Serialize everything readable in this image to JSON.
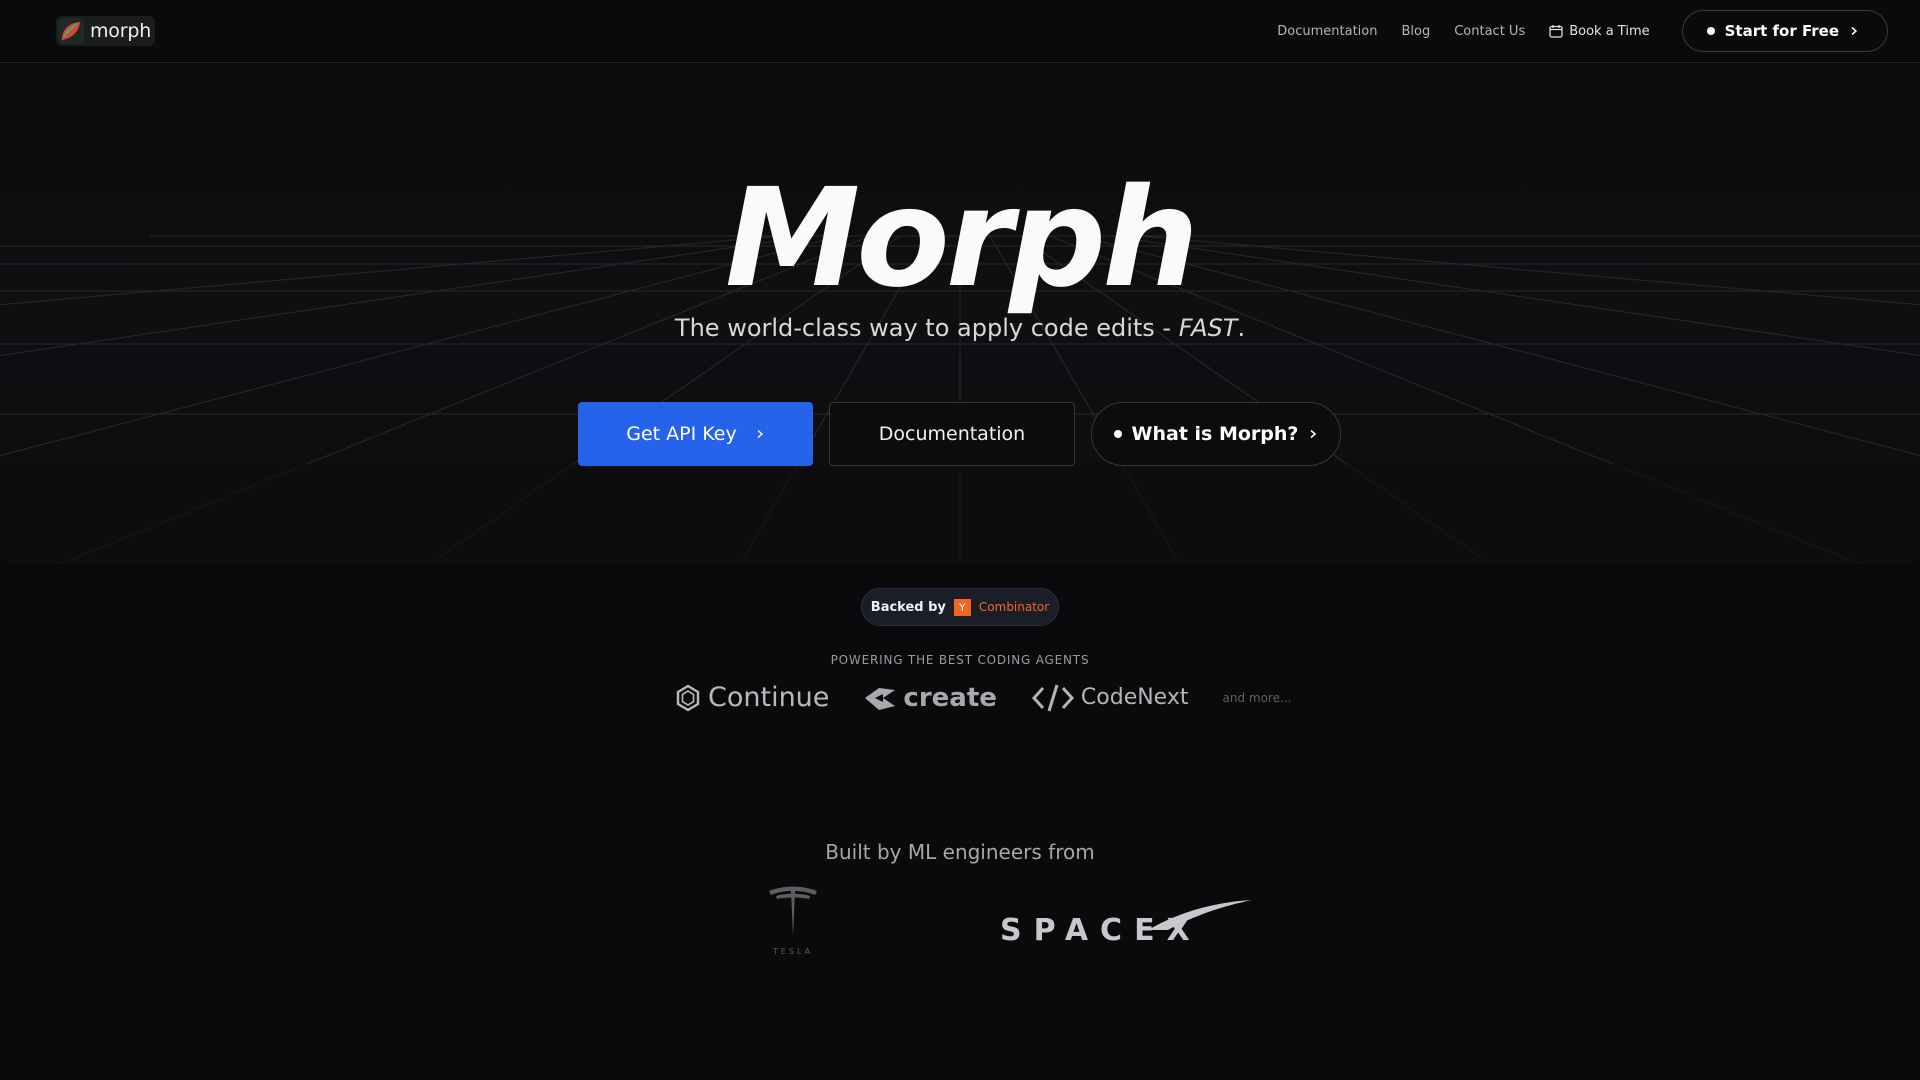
{
  "nav": {
    "logo_text": "morph",
    "links": [
      "Documentation",
      "Blog",
      "Contact Us"
    ],
    "book_label": "Book a Time",
    "cta_label": "Start for Free",
    "icons": [
      "logo-mark-icon",
      "calendar-icon",
      "dot-icon",
      "chevron-right-icon"
    ]
  },
  "hero": {
    "title": "Morph",
    "subtitle_main": "The world-class way to apply code edits - ",
    "subtitle_emph": "FAST",
    "subtitle_end": ".",
    "primary_button": "Get API Key",
    "secondary_button": "Documentation",
    "pill_button": "What is Morph?"
  },
  "backed": {
    "label": "Backed by",
    "yc_letter": "Y",
    "yc_name": "Combinator"
  },
  "agents": {
    "heading": "POWERING THE BEST CODING AGENTS",
    "partners": [
      "Continue",
      "create",
      "CodeNext"
    ],
    "more": "and more..."
  },
  "builders": {
    "heading": "Built by ML engineers from",
    "companies": [
      "TESLA",
      "SPACEX"
    ]
  },
  "colors": {
    "background": "#0a0a0c",
    "primary": "#2563eb",
    "yc_orange": "#f26522",
    "logo_green": "#5aa66a",
    "logo_red": "#d9443a"
  }
}
